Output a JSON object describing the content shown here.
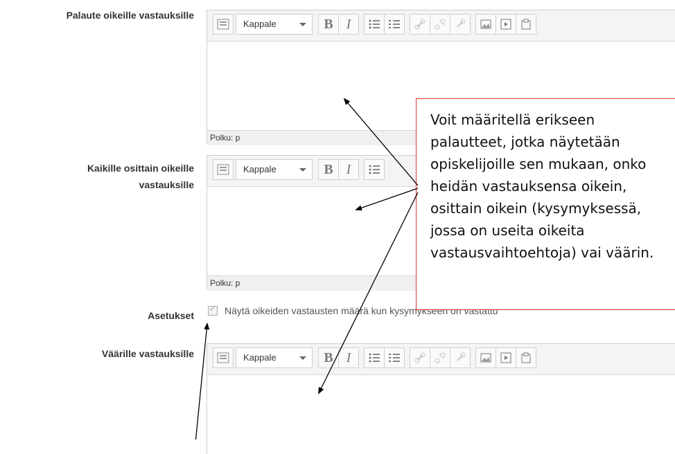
{
  "labels": {
    "correct": "Palaute oikeille vastauksille",
    "partial_line1": "Kaikille osittain oikeille",
    "partial_line2": "vastauksille",
    "settings": "Asetukset",
    "incorrect": "Väärille vastauksille"
  },
  "editor": {
    "format_value": "Kappale",
    "path_label": "Polku: p",
    "icons": [
      "toolbar-toggle-icon",
      "bold-icon",
      "italic-icon",
      "bullet-list-icon",
      "numbered-list-icon",
      "link-icon",
      "unlink-icon",
      "anchor-icon",
      "image-icon",
      "media-icon",
      "paste-icon"
    ]
  },
  "settings": {
    "checkbox_label": "Näytä oikeiden vastausten määrä kun kysymykseen on vastattu",
    "checked": true
  },
  "callout": {
    "text": "Voit määritellä erikseen\npalautteet, jotka näytetään\nopiskelijoille sen mukaan, onko\nheidän vastauksensa oikein,\nosittain oikein (kysymyksessä,\njossa on useita oikeita\nvastausvaihtoehtoja) vai väärin."
  },
  "colors": {
    "callout_border": "#e03030",
    "toolbar_bg": "#f4f4f4",
    "border": "#cfcfcf"
  }
}
